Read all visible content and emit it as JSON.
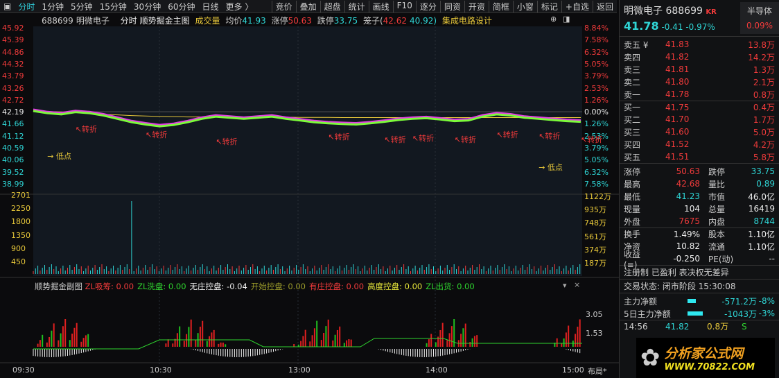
{
  "toolbar": {
    "periods": [
      "分时",
      "1分钟",
      "5分钟",
      "15分钟",
      "30分钟",
      "60分钟",
      "日线",
      "更多 〉"
    ],
    "tools": [
      "竞价",
      "叠加",
      "超盘",
      "统计",
      "画线",
      "F10",
      "逐分",
      "同资",
      "开资",
      "简框",
      "小窗",
      "标记",
      "+自选",
      "返回"
    ]
  },
  "info": {
    "code": "688699",
    "name": "明微电子",
    "mode": "分时",
    "main": "顺势掘金主图",
    "vol": "成交量",
    "avg_label": "均价",
    "avg": "41.93",
    "up_label": "涨停",
    "up": "50.63",
    "down_label": "跌停",
    "down": "33.75",
    "cage_label": "笼子(",
    "cage1": "42.62",
    "cage2": "40.92)",
    "sector": "集成电路设计"
  },
  "price_axis": [
    "45.92",
    "45.39",
    "44.86",
    "44.32",
    "43.79",
    "43.26",
    "42.72",
    "42.19",
    "41.66",
    "41.12",
    "40.59",
    "40.06",
    "39.52",
    "38.99"
  ],
  "pct_axis": [
    "8.84%",
    "7.58%",
    "6.32%",
    "5.05%",
    "3.79%",
    "2.53%",
    "1.26%",
    "0.00%",
    "1.26%",
    "2.53%",
    "3.79%",
    "5.05%",
    "6.32%",
    "7.58%"
  ],
  "vol_axis": [
    "2701",
    "2250",
    "1800",
    "1350",
    "900",
    "450"
  ],
  "vol_axis_r": [
    "1122万",
    "935万",
    "748万",
    "561万",
    "374万",
    "187万"
  ],
  "sub": {
    "title": "顺势掘金副图",
    "items": [
      {
        "k": "ZL吸筹:",
        "v": "0.00",
        "c": "#f23b3b"
      },
      {
        "k": "ZL洗盘:",
        "v": "0.00",
        "c": "#2fd62f"
      },
      {
        "k": "无庄控盘:",
        "v": "-0.04",
        "c": "#eeeeee"
      },
      {
        "k": "开始控盘:",
        "v": "0.00",
        "c": "#9a9a2a"
      },
      {
        "k": "有庄控盘:",
        "v": "0.00",
        "c": "#f23b3b"
      },
      {
        "k": "高度控盘:",
        "v": "0.00",
        "c": "#e8e83a"
      },
      {
        "k": "ZL出货:",
        "v": "0.00",
        "c": "#2fd62f"
      }
    ],
    "axis": [
      "3.05",
      "1.53"
    ]
  },
  "time_axis": [
    "09:30",
    "10:30",
    "13:00",
    "14:00",
    "15:00"
  ],
  "layout_btn": "布局*",
  "chart_data": {
    "type": "line",
    "prev_close": 42.19,
    "ylim": [
      38.99,
      45.92
    ],
    "price": [
      42.3,
      42.2,
      42.15,
      42.25,
      42.2,
      42.1,
      41.95,
      41.8,
      41.7,
      41.62,
      41.68,
      41.8,
      41.95,
      42.05,
      42.0,
      41.95,
      42.0,
      42.05,
      41.95,
      41.88,
      41.8,
      41.75,
      41.72,
      41.7,
      41.75,
      41.82,
      41.9,
      41.95,
      41.98,
      41.92,
      41.85,
      41.88,
      42.05,
      42.15,
      42.1,
      42.0,
      41.95,
      41.9,
      41.85,
      41.82
    ],
    "avg": [
      42.2,
      42.2,
      42.18,
      42.15,
      42.12,
      42.08,
      42.05,
      42.02,
      42.0,
      41.98,
      41.97,
      41.96,
      41.96,
      41.96,
      41.96,
      41.95,
      41.95,
      41.95,
      41.95,
      41.94,
      41.94,
      41.94,
      41.93,
      41.93,
      41.93,
      41.93,
      41.93,
      41.93,
      41.93,
      41.93,
      41.93,
      41.93,
      41.93,
      41.93,
      41.93,
      41.93,
      41.93,
      41.93,
      41.93,
      41.93
    ],
    "annotations": [
      {
        "t": "↖转折",
        "i": 3,
        "p": 41.45
      },
      {
        "t": "↖转折",
        "i": 8,
        "p": 41.2
      },
      {
        "t": "↖转折",
        "i": 13,
        "p": 40.9
      },
      {
        "t": "↖转折",
        "i": 21,
        "p": 41.1
      },
      {
        "t": "↖转折",
        "i": 27,
        "p": 41.05
      },
      {
        "t": "↖转折",
        "i": 30,
        "p": 41.0
      },
      {
        "t": "↖转折",
        "i": 33,
        "p": 41.2
      },
      {
        "t": "↖转折",
        "i": 36,
        "p": 41.15
      },
      {
        "t": "↖转折",
        "i": 25,
        "p": 41.0
      },
      {
        "t": "↖转折",
        "i": 39,
        "p": 41.0
      },
      {
        "t": "→ 低点",
        "i": 1,
        "p": 40.25
      },
      {
        "t": "→ 低点",
        "i": 36,
        "p": 39.75
      }
    ]
  },
  "quote": {
    "name": "明微电子",
    "code": "688699",
    "tag": "KR",
    "sector": "半导体",
    "sector_pct": "0.09%",
    "price": "41.78",
    "chg": "-0.41",
    "pct": "-0.97%"
  },
  "book": [
    {
      "l": "卖五 ¥",
      "p": "41.83",
      "v": "13.8万",
      "c": "red"
    },
    {
      "l": "卖四",
      "p": "41.82",
      "v": "14.2万",
      "c": "red"
    },
    {
      "l": "卖三",
      "p": "41.81",
      "v": "1.3万",
      "c": "red"
    },
    {
      "l": "卖二",
      "p": "41.80",
      "v": "2.1万",
      "c": "red"
    },
    {
      "l": "卖一",
      "p": "41.78",
      "v": "0.8万",
      "c": "red"
    },
    {
      "l": "买一",
      "p": "41.75",
      "v": "0.4万",
      "c": "red"
    },
    {
      "l": "买二",
      "p": "41.70",
      "v": "1.7万",
      "c": "red"
    },
    {
      "l": "买三",
      "p": "41.60",
      "v": "5.0万",
      "c": "red"
    },
    {
      "l": "买四",
      "p": "41.52",
      "v": "4.2万",
      "c": "red"
    },
    {
      "l": "买五",
      "p": "41.51",
      "v": "5.8万",
      "c": "red"
    }
  ],
  "stats": [
    [
      "涨停",
      "50.63",
      "red",
      "跌停",
      "33.75",
      "cy"
    ],
    [
      "最高",
      "42.68",
      "red",
      "量比",
      "0.89",
      "cy"
    ],
    [
      "最低",
      "41.23",
      "cy",
      "市值",
      "46.0亿",
      "wh"
    ],
    [
      "现量",
      "104",
      "wh",
      "总量",
      "16419",
      "wh"
    ],
    [
      "外盘",
      "7675",
      "red",
      "内盘",
      "8744",
      "cy"
    ],
    [
      "换手",
      "1.49%",
      "wh",
      "股本",
      "1.10亿",
      "wh"
    ],
    [
      "净资",
      "10.82",
      "wh",
      "流通",
      "1.10亿",
      "wh"
    ],
    [
      "收益(≡)",
      "-0.250",
      "wh",
      "PE(动)",
      "--",
      "wh"
    ]
  ],
  "tags": "注册制 已盈利 表决权无差异",
  "status": "交易状态: 闭市阶段 15:30:08",
  "flow": [
    {
      "l": "主力净额",
      "v": "-571.2万",
      "p": "-8%"
    },
    {
      "l": "5日主力净额",
      "v": "-1043万",
      "p": "-3%"
    }
  ],
  "tick": {
    "t": "14:56",
    "p": "41.82",
    "v": "0.8万",
    "s": "S"
  },
  "logo": {
    "cn": "分析家公式网",
    "url": "WWW.70822.COM"
  }
}
